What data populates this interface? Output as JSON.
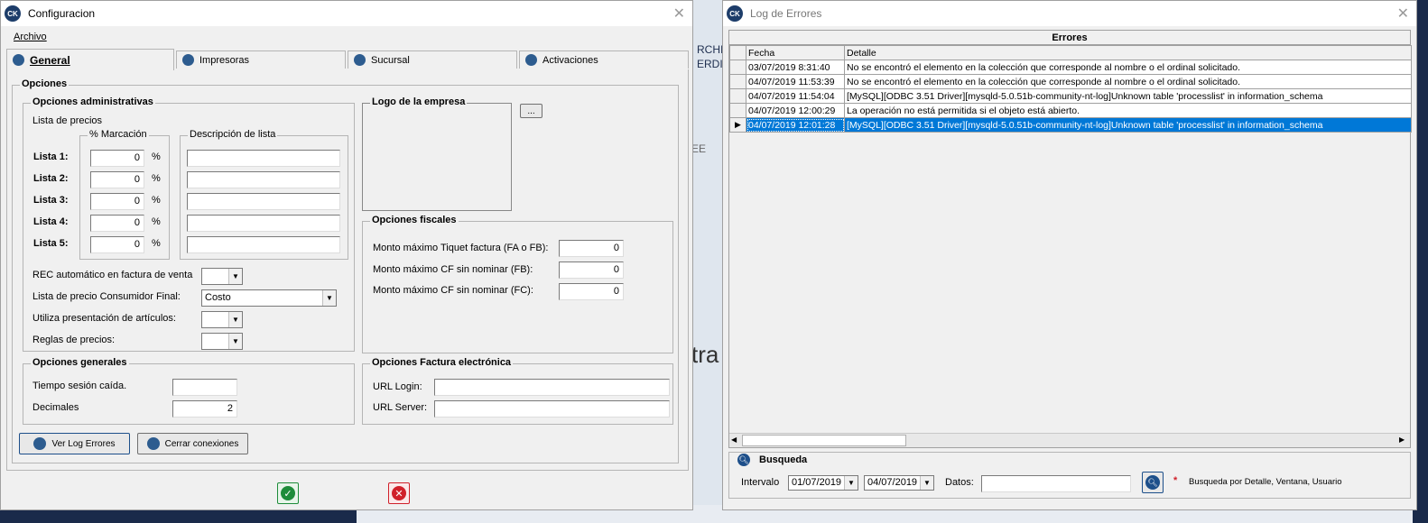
{
  "background": {
    "text1": "RCHIV",
    "text2": "ERDID",
    "text3": "EE",
    "text4": "tra"
  },
  "config": {
    "title": "Configuracion",
    "menu": "Archivo",
    "tabs": [
      "General",
      "Impresoras",
      "Sucursal",
      "Activaciones"
    ],
    "opciones_label": "Opciones",
    "admin": {
      "label": "Opciones administrativas",
      "lista_precios": "Lista de precios",
      "marcacion_label": "% Marcación",
      "descripcion_label": "Descripción de lista",
      "rows": [
        {
          "label": "Lista 1:",
          "value": "0",
          "pct": "%",
          "desc": ""
        },
        {
          "label": "Lista 2:",
          "value": "0",
          "pct": "%",
          "desc": ""
        },
        {
          "label": "Lista 3:",
          "value": "0",
          "pct": "%",
          "desc": ""
        },
        {
          "label": "Lista 4:",
          "value": "0",
          "pct": "%",
          "desc": ""
        },
        {
          "label": "Lista 5:",
          "value": "0",
          "pct": "%",
          "desc": ""
        }
      ],
      "rec_label": "REC automático en factura de venta",
      "rec_value": "",
      "consumidor_label": "Lista de precio Consumidor Final:",
      "consumidor_value": "Costo",
      "presentacion_label": "Utiliza presentación de artículos:",
      "presentacion_value": "",
      "reglas_label": "Reglas de precios:",
      "reglas_value": ""
    },
    "logo": {
      "label": "Logo de la empresa",
      "browse": "..."
    },
    "fiscales": {
      "label": "Opciones fiscales",
      "rows": [
        {
          "label": "Monto máximo Tiquet factura (FA o FB):",
          "value": "0"
        },
        {
          "label": "Monto máximo CF sin nominar (FB):",
          "value": "0"
        },
        {
          "label": "Monto máximo CF sin nominar (FC):",
          "value": "0"
        }
      ]
    },
    "generales": {
      "label": "Opciones generales",
      "tiempo_label": "Tiempo sesión caída.",
      "tiempo_value": "",
      "decimales_label": "Decimales",
      "decimales_value": "2"
    },
    "factura": {
      "label": "Opciones Factura electrónica",
      "login_label": "URL Login:",
      "login_value": "",
      "server_label": "URL Server:",
      "server_value": ""
    },
    "buttons": {
      "log": "Ver Log Errores",
      "cerrar": "Cerrar conexiones"
    },
    "colors": {
      "ok": "#1e8c3a",
      "cancel": "#d0202a",
      "accent": "#2d5c8f"
    }
  },
  "log": {
    "title": "Log de Errores",
    "grid_title": "Errores",
    "columns": [
      "Fecha",
      "Detalle"
    ],
    "rows": [
      {
        "fecha": "03/07/2019 8:31:40",
        "detalle": "No se encontró el elemento en la colección que corresponde al nombre o el ordinal solicitado."
      },
      {
        "fecha": "04/07/2019 11:53:39",
        "detalle": "No se encontró el elemento en la colección que corresponde al nombre o el ordinal solicitado."
      },
      {
        "fecha": "04/07/2019 11:54:04",
        "detalle": "[MySQL][ODBC 3.51 Driver][mysqld-5.0.51b-community-nt-log]Unknown table 'processlist' in information_schema"
      },
      {
        "fecha": "04/07/2019 12:00:29",
        "detalle": "La operación no está permitida si el objeto está abierto."
      },
      {
        "fecha": "04/07/2019 12:01:28",
        "detalle": "[MySQL][ODBC 3.51 Driver][mysqld-5.0.51b-community-nt-log]Unknown table 'processlist' in information_schema"
      }
    ],
    "selected_row": 4,
    "busqueda": {
      "label": "Busqueda",
      "intervalo_label": "Intervalo",
      "desde": "01/07/2019",
      "hasta": "04/07/2019",
      "datos_label": "Datos:",
      "datos_value": "",
      "hint_star": "*",
      "hint": "Busqueda por Detalle, Ventana, Usuario"
    },
    "colors": {
      "selected": "#0078d7"
    }
  }
}
